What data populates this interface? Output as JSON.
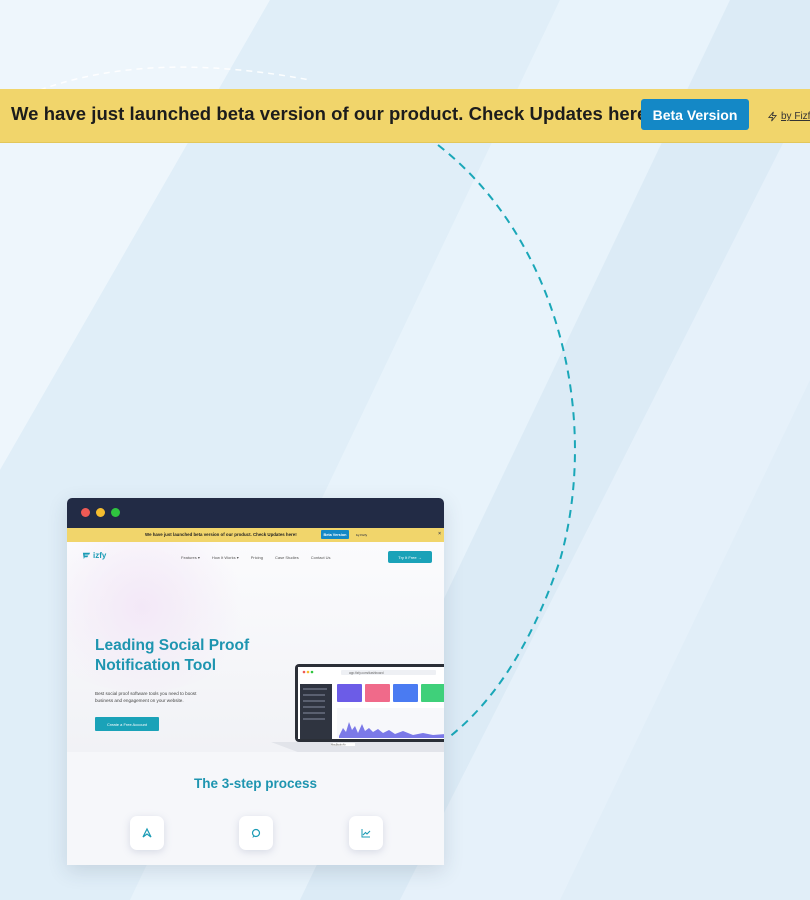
{
  "announcement": {
    "text": "We have just launched beta version of our product. Check Updates here!",
    "button_label": "Beta Version",
    "byline": "by Fizfy",
    "colors": {
      "bar": "#f1d56b",
      "button": "#1488c6"
    }
  },
  "preview": {
    "announcement_text": "We have just launched beta version of our product. Check Updates here!",
    "announcement_button": "Beta Version",
    "announcement_byline": "by Fizfy",
    "close_glyph": "×",
    "logo_text": "izfy",
    "nav_items": [
      "Features ▾",
      "How It Works ▾",
      "Pricing",
      "Case Studies",
      "Contact Us"
    ],
    "nav_cta": "Try It Free →",
    "hero_title_line1": "Leading Social Proof",
    "hero_title_line2": "Notification Tool",
    "hero_subtitle": "Best social proof software tools you need to boost business and engagement on your website.",
    "hero_cta": "Create a Free Account",
    "laptop_url": "app.fizfy.com/dashboard",
    "laptop_label": "MacBook Air",
    "process_title": "The 3-step process",
    "step_icons": [
      "rocket-icon",
      "chat-icon",
      "chart-icon"
    ]
  }
}
